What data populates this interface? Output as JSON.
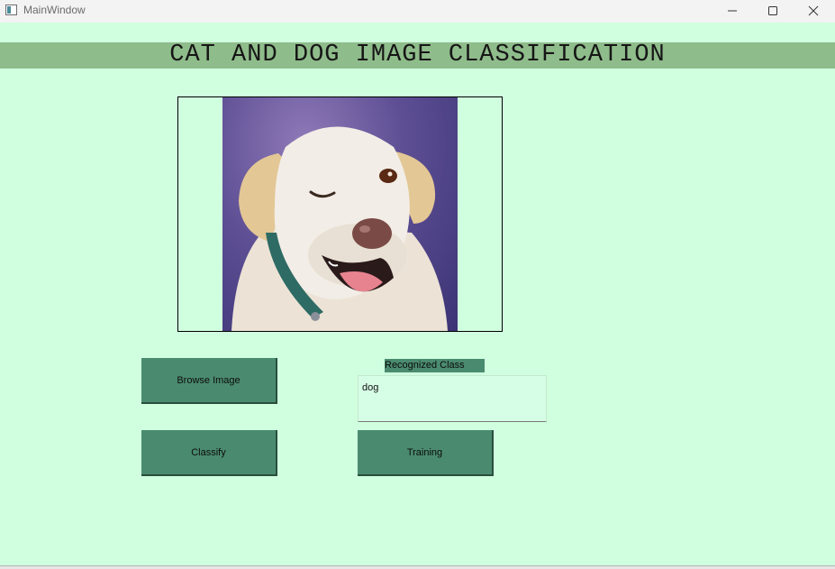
{
  "window": {
    "title": "MainWindow",
    "controls": {
      "minimize": "minimize-icon",
      "maximize": "maximize-icon",
      "close": "close-icon"
    }
  },
  "header": {
    "title": "CAT AND DOG IMAGE CLASSIFICATION"
  },
  "buttons": {
    "browse": "Browse Image",
    "classify": "Classify",
    "training": "Training"
  },
  "result": {
    "label": "Recognized Class",
    "value": "dog"
  },
  "colors": {
    "background": "#d0ffdf",
    "banner": "#8fbc8b",
    "button": "#4a8b6f"
  }
}
